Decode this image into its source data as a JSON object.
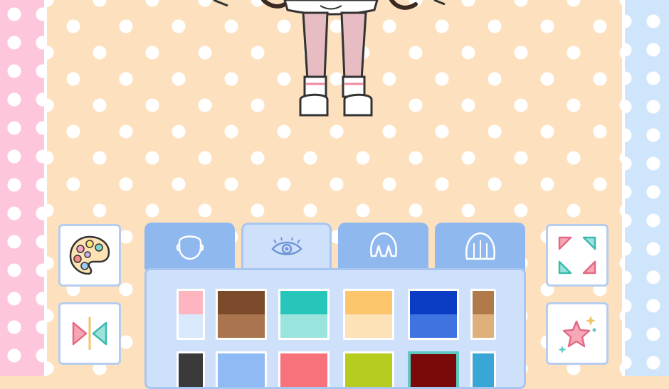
{
  "app": {
    "screen": "character-creator"
  },
  "colors": {
    "stage_bg": "#fde0bd",
    "left_stripe": "#fdc6dc",
    "right_stripe": "#cfe5fb",
    "panel": "#cfe0fb",
    "tab": "#8fb8ef"
  },
  "left_buttons": [
    {
      "icon": "palette-icon"
    },
    {
      "icon": "flip-icon"
    }
  ],
  "right_buttons": [
    {
      "icon": "zoom-fullscreen-icon"
    },
    {
      "icon": "star-effects-icon"
    }
  ],
  "tabs": [
    {
      "icon": "face-shape-icon",
      "active": false
    },
    {
      "icon": "eye-icon",
      "active": true
    },
    {
      "icon": "front-hair-icon",
      "active": false
    },
    {
      "icon": "back-hair-icon",
      "active": false
    }
  ],
  "swatches_row1": [
    {
      "top": "#fdb6c0",
      "bottom": "#d9e8fb"
    },
    {
      "top": "#7a4a2a",
      "bottom": "#a9744e"
    },
    {
      "top": "#27c6ba",
      "bottom": "#9ae4de"
    },
    {
      "top": "#fdc56c",
      "bottom": "#fde2b8"
    },
    {
      "top": "#0a3cc4",
      "bottom": "#3f74e0"
    },
    {
      "top": "#b07a4a",
      "bottom": "#e0b07c"
    }
  ],
  "swatches_row2": [
    {
      "top": "#3a3a3a",
      "bottom": "#3a3a3a"
    },
    {
      "top": "#8fbaf3",
      "bottom": "#8fbaf3"
    },
    {
      "top": "#f7727a",
      "bottom": "#f7727a"
    },
    {
      "top": "#b6cc1e",
      "bottom": "#b6cc1e"
    },
    {
      "top": "#7a0a0a",
      "bottom": "#7a0a0a",
      "selected": true
    },
    {
      "top": "#3aa6d6",
      "bottom": "#3aa6d6"
    }
  ]
}
